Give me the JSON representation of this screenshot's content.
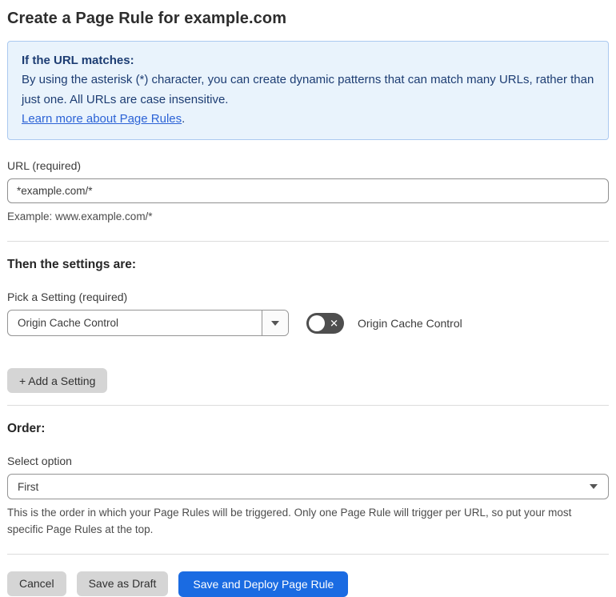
{
  "page": {
    "title": "Create a Page Rule for example.com"
  },
  "info_box": {
    "heading": "If the URL matches:",
    "body": "By using the asterisk (*) character, you can create dynamic patterns that can match many URLs, rather than just one. All URLs are case insensitive.",
    "link_label": "Learn more about Page Rules",
    "link_suffix": "."
  },
  "url_section": {
    "label": "URL (required)",
    "input_value": "*example.com/*",
    "helper": "Example: www.example.com/*"
  },
  "settings_section": {
    "heading": "Then the settings are:",
    "picker_label": "Pick a Setting (required)",
    "selected_setting": "Origin Cache Control",
    "toggle_state": "off",
    "toggle_icon": "✕",
    "toggle_label": "Origin Cache Control",
    "add_button_label": "+ Add a Setting"
  },
  "order_section": {
    "heading": "Order:",
    "label": "Select option",
    "selected_option": "First",
    "helper": "This is the order in which your Page Rules will be triggered. Only one Page Rule will trigger per URL, so put your most specific Page Rules at the top."
  },
  "footer": {
    "cancel_label": "Cancel",
    "save_draft_label": "Save as Draft",
    "save_deploy_label": "Save and Deploy Page Rule"
  },
  "colors": {
    "info_bg": "#e9f3fc",
    "info_border": "#abc9f0",
    "info_text": "#1d3d73",
    "link_blue": "#2c63d6",
    "primary_button_blue": "#1a6be2",
    "gray_button": "#d5d5d5",
    "toggle_off_bg": "#4e4e4e"
  }
}
